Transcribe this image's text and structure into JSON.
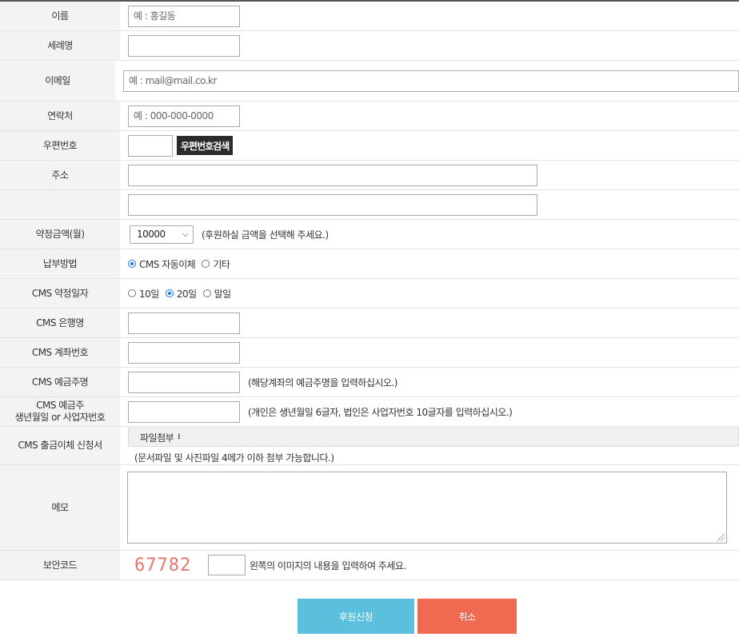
{
  "fields": {
    "name": {
      "label": "이름",
      "placeholder": "예 : 홍길동"
    },
    "baptismal": {
      "label": "세례명"
    },
    "email": {
      "label": "이메일",
      "placeholder": "예 : mail@mail.co.kr"
    },
    "phone": {
      "label": "연락처",
      "placeholder": "예 : 000-000-0000"
    },
    "zipcode": {
      "label": "우편번호",
      "search_button": "우편번호검색"
    },
    "address": {
      "label": "주소"
    },
    "amount": {
      "label": "약정금액(월)",
      "selected": "10000",
      "hint": "(후원하실 금액을 선택해 주세요.)"
    },
    "payment": {
      "label": "납부방법",
      "options": [
        {
          "label": "CMS 자동이체",
          "checked": true
        },
        {
          "label": "기타",
          "checked": false
        }
      ]
    },
    "cms_day": {
      "label": "CMS 약정일자",
      "options": [
        {
          "label": "10일",
          "checked": false
        },
        {
          "label": "20일",
          "checked": true
        },
        {
          "label": "말일",
          "checked": false
        }
      ]
    },
    "cms_bank": {
      "label": "CMS 은행명"
    },
    "cms_account": {
      "label": "CMS 계좌번호"
    },
    "cms_holder": {
      "label": "CMS 예금주명",
      "hint": "(해당계좌의 예금주명을 입력하십시오.)"
    },
    "cms_birth": {
      "label_line1": "CMS 예금주",
      "label_line2": "생년월일 or 사업자번호",
      "hint": "(개인은 생년월일 6글자, 법인은 사업자번호 10글자를 입력하십시오.)"
    },
    "cms_form": {
      "label": "CMS 출금이체 신청서",
      "button": "파일첨부",
      "icon": "upload-icon",
      "hint": "(문서파일 및 사진파일 4메가 이하 첨부 가능합니다.)"
    },
    "memo": {
      "label": "메모"
    },
    "captcha": {
      "label": "보안코드",
      "code": "67782",
      "hint": "왼쪽의 이미지의 내용을 입력하여 주세요."
    }
  },
  "actions": {
    "submit": "후원신청",
    "cancel": "취소"
  },
  "colors": {
    "submit": "#5bc0de",
    "cancel": "#f06a52",
    "captcha": "#e8756a",
    "zip_button": "#2b2b2b"
  }
}
